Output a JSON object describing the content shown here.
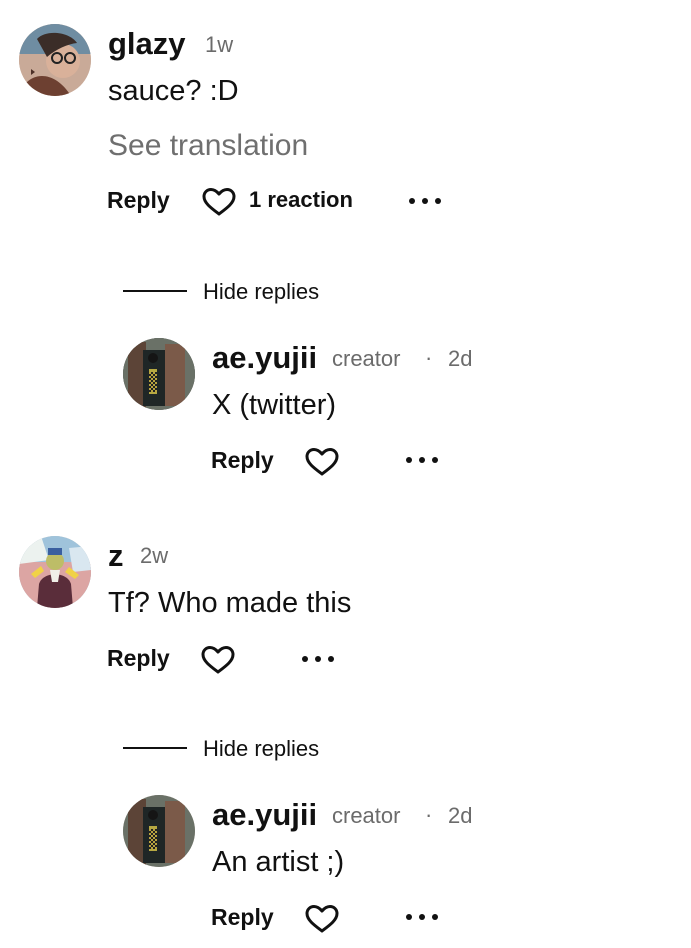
{
  "comments": [
    {
      "user": "glazy",
      "time": "1w",
      "text": "sauce? :D",
      "translation_label": "See translation",
      "reply_label": "Reply",
      "reactions": "1 reaction",
      "avatar_icon": "user-avatar-photo"
    },
    {
      "user": "z",
      "time": "2w",
      "text": "Tf? Who made this",
      "reply_label": "Reply",
      "avatar_icon": "user-avatar-illustration"
    }
  ],
  "threads": [
    {
      "hide_label": "Hide replies",
      "reply": {
        "user": "ae.yujii",
        "role": "creator",
        "separator": "·",
        "time": "2d",
        "text": "X (twitter)",
        "reply_label": "Reply",
        "avatar_icon": "creator-avatar-photo"
      }
    },
    {
      "hide_label": "Hide replies",
      "reply": {
        "user": "ae.yujii",
        "role": "creator",
        "separator": "·",
        "time": "2d",
        "text": "An artist ;)",
        "reply_label": "Reply",
        "avatar_icon": "creator-avatar-photo"
      }
    }
  ],
  "colors": {
    "text": "#111111",
    "muted": "#6b6b6b",
    "background": "#ffffff"
  }
}
